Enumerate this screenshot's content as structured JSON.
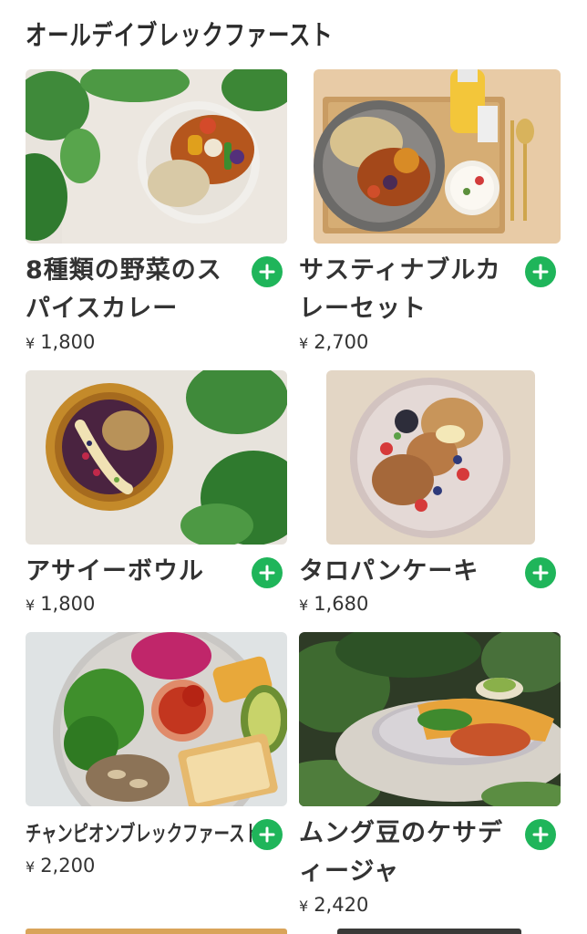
{
  "section": {
    "title": "オールデイブレックファースト"
  },
  "colors": {
    "accent": "#1fb55a",
    "text": "#333333"
  },
  "menu_items": [
    {
      "name": "8種類の野菜のスパイスカレー",
      "price_symbol": "¥",
      "price": "1,800",
      "image_icon": "spice-curry-photo"
    },
    {
      "name": "サスティナブルカレーセット",
      "price_symbol": "¥",
      "price": "2,700",
      "image_icon": "curry-set-photo"
    },
    {
      "name": "アサイーボウル",
      "price_symbol": "¥",
      "price": "1,800",
      "image_icon": "acai-bowl-photo"
    },
    {
      "name": "タロパンケーキ",
      "price_symbol": "¥",
      "price": "1,680",
      "image_icon": "taro-pancake-photo"
    },
    {
      "name": "チャンピオンブレックファースト",
      "price_symbol": "¥",
      "price": "2,200",
      "image_icon": "champion-breakfast-photo"
    },
    {
      "name": "ムング豆のケサディージャ",
      "price_symbol": "¥",
      "price": "2,420",
      "image_icon": "mung-bean-quesadilla-photo"
    }
  ],
  "add_button_icon": "plus-icon"
}
